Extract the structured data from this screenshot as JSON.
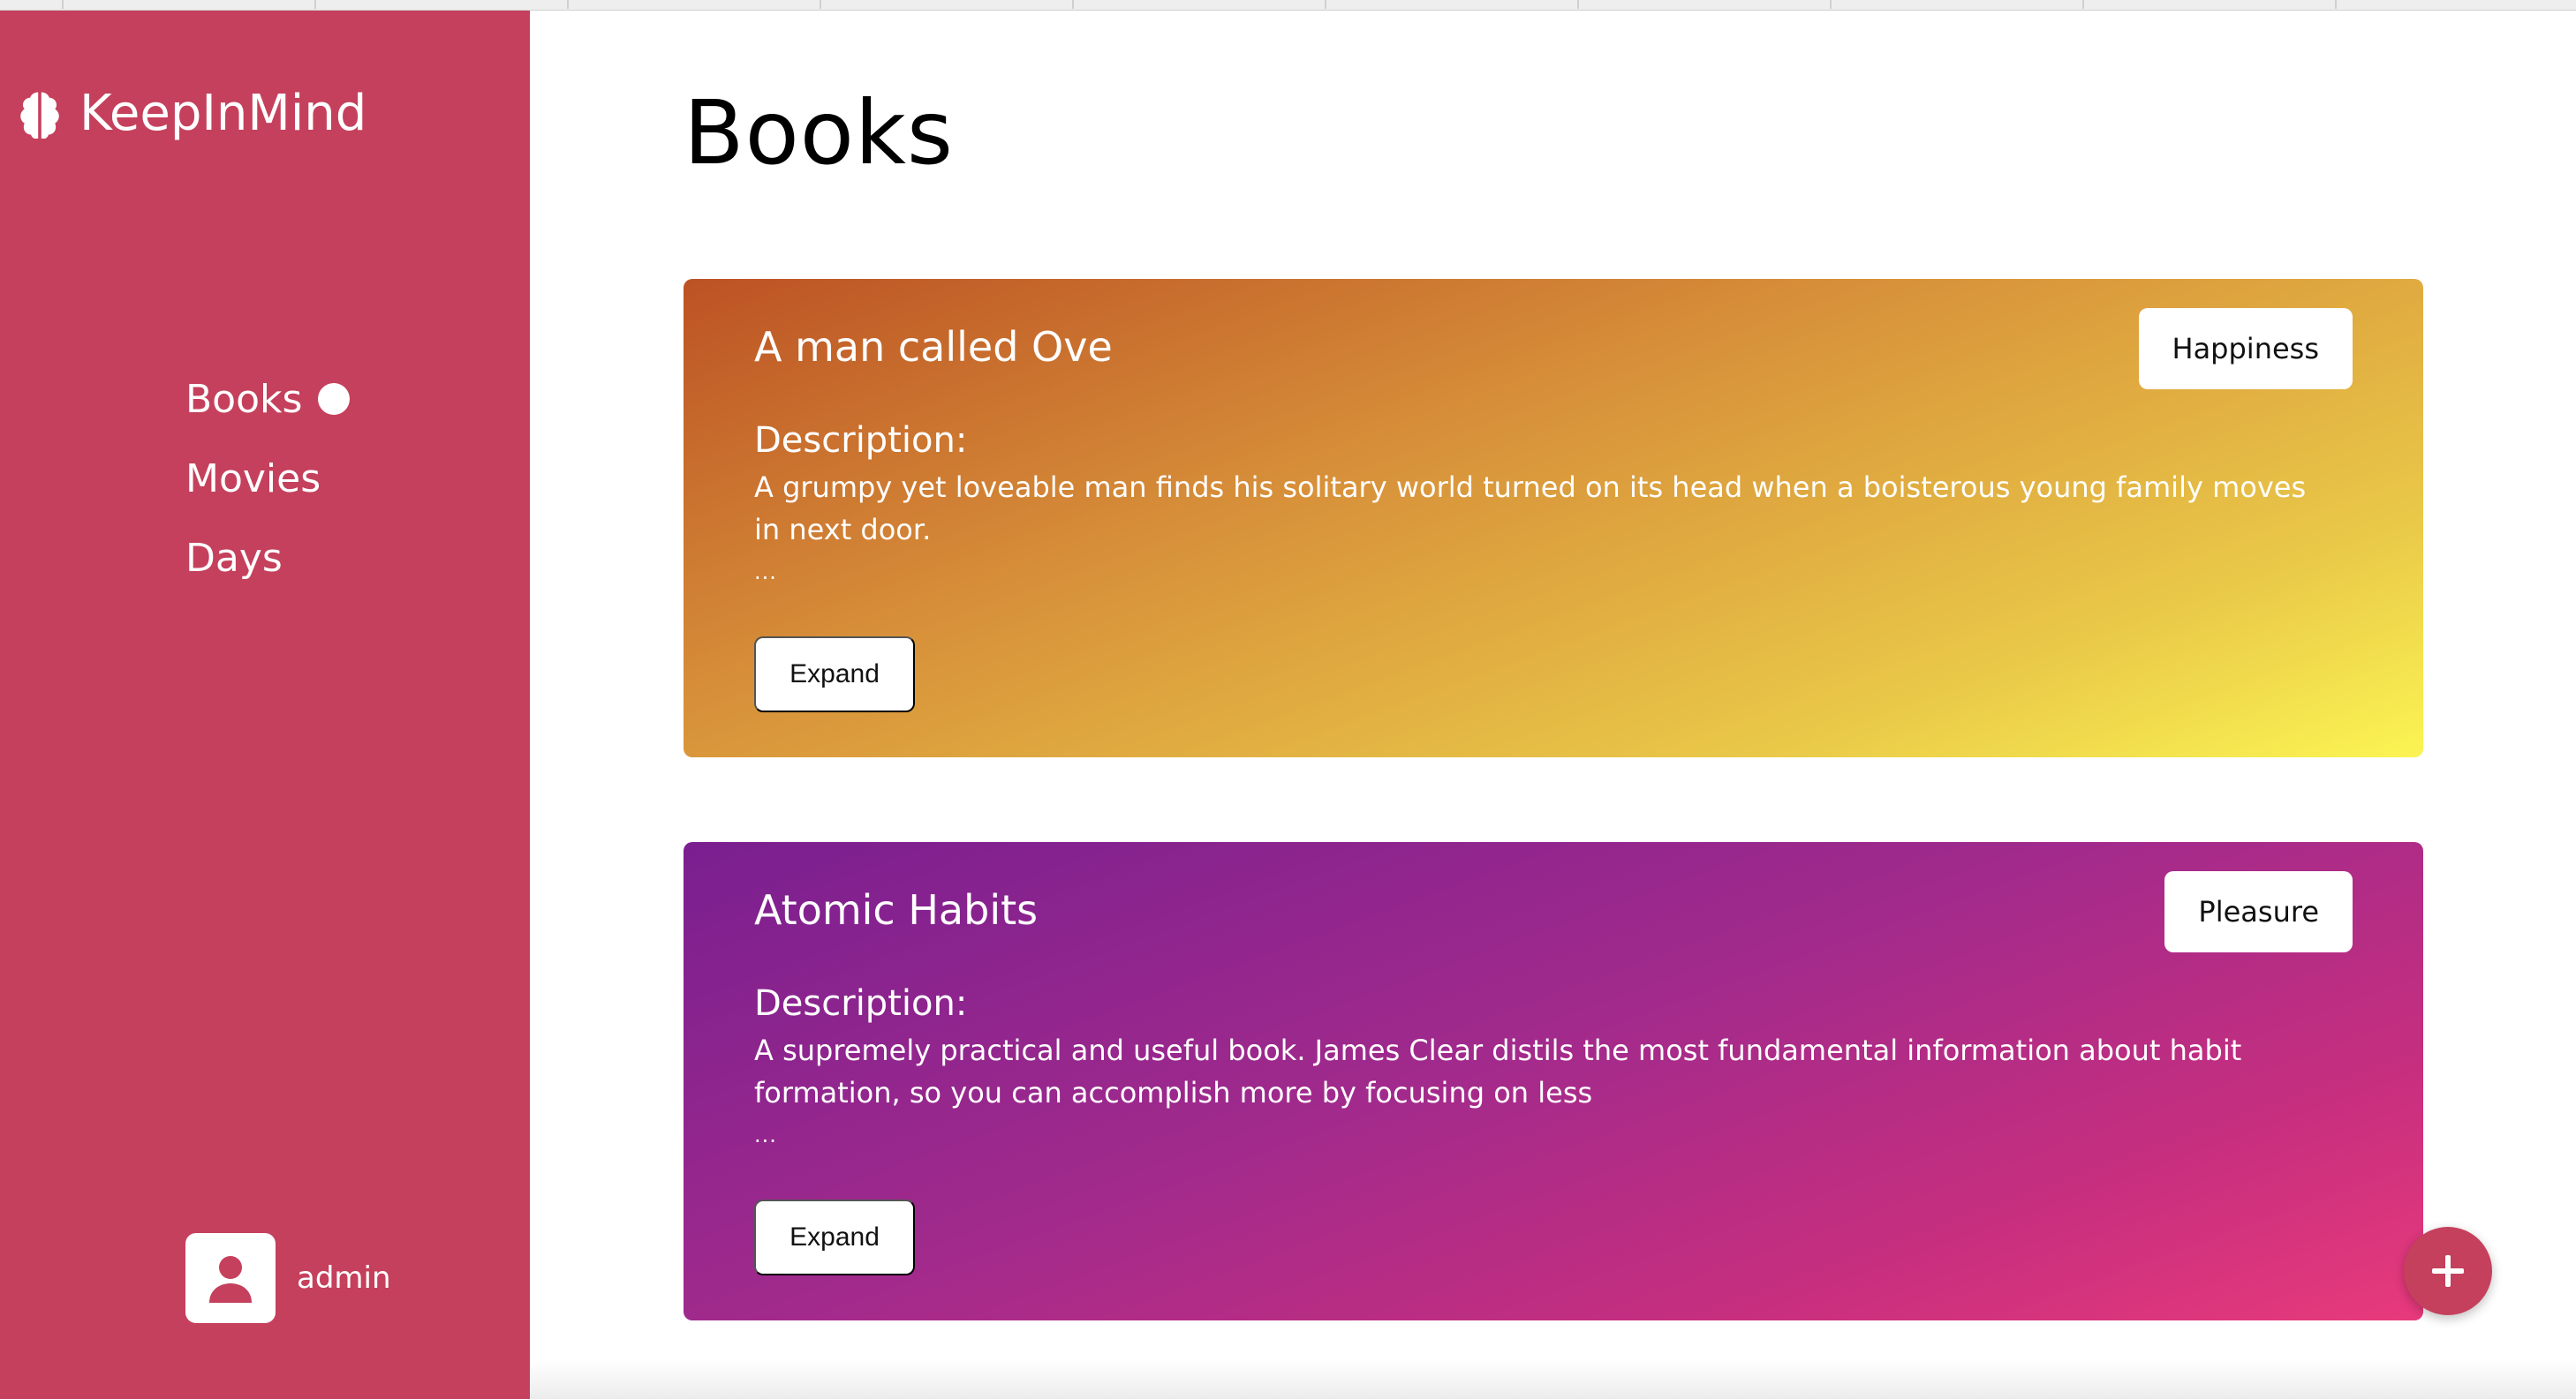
{
  "app": {
    "name": "KeepInMind"
  },
  "nav": {
    "items": [
      {
        "label": "Books",
        "active": true
      },
      {
        "label": "Movies",
        "active": false
      },
      {
        "label": "Days",
        "active": false
      }
    ]
  },
  "user": {
    "name": "admin"
  },
  "page": {
    "title": "Books"
  },
  "cards": [
    {
      "title": "A man called Ove",
      "tag": "Happiness",
      "description_label": "Description:",
      "description": "A grumpy yet loveable man finds his solitary world turned on its head when a boisterous young family moves in next door.",
      "ellipsis": "...",
      "expand_label": "Expand"
    },
    {
      "title": "Atomic Habits",
      "tag": "Pleasure",
      "description_label": "Description:",
      "description": "A supremely practical and useful book. James Clear distils the most fundamental information about habit formation, so you can accomplish more by focusing on less",
      "ellipsis": "...",
      "expand_label": "Expand"
    }
  ],
  "colors": {
    "sidebar": "#c5405c",
    "accent": "#c5405c",
    "card1_start": "#bc5224",
    "card1_end": "#fbf453",
    "card2_start": "#7a1f90",
    "card2_end": "#e83a7c"
  },
  "icons": {
    "logo": "brain-icon",
    "avatar": "user-icon",
    "fab": "plus-icon",
    "active_marker": "dot-icon"
  }
}
